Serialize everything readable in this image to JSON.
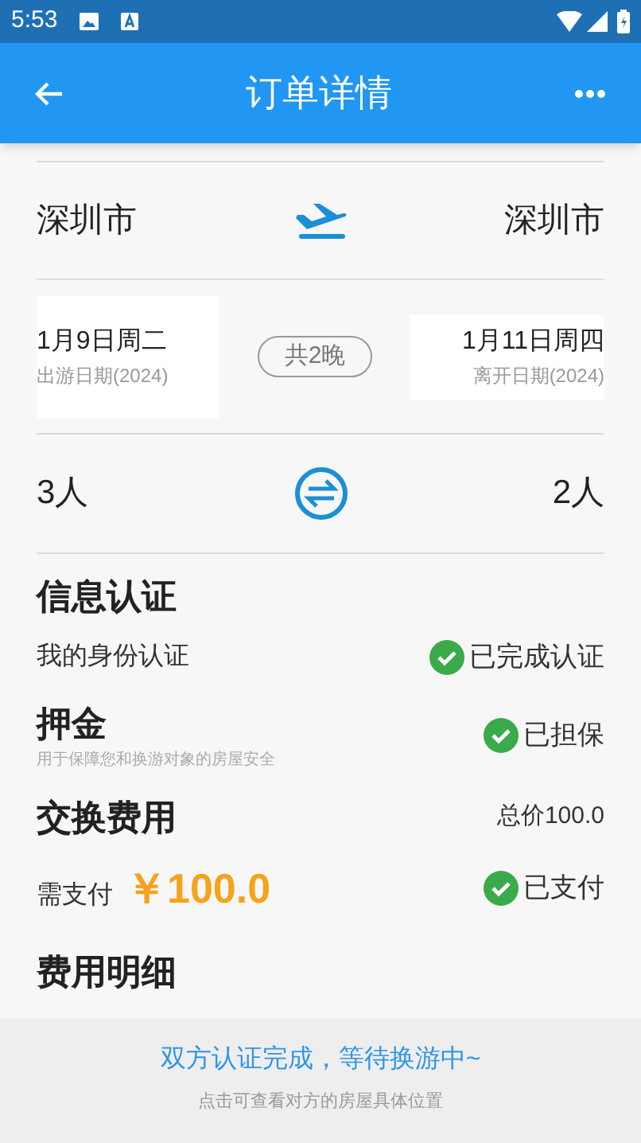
{
  "status_bar": {
    "time": "5:53"
  },
  "app_bar": {
    "title": "订单详情"
  },
  "route": {
    "from": "深圳市",
    "to": "深圳市"
  },
  "dates": {
    "start": {
      "date": "1月9日周二",
      "label": "出游日期(2024)"
    },
    "nights": "共2晚",
    "end": {
      "date": "1月11日周四",
      "label": "离开日期(2024)"
    }
  },
  "people": {
    "left": "3人",
    "right": "2人"
  },
  "verification": {
    "title": "信息认证",
    "label": "我的身份认证",
    "status": "已完成认证",
    "done": true
  },
  "deposit": {
    "title": "押金",
    "note": "用于保障您和换游对象的房屋安全",
    "status": "已担保",
    "done": true
  },
  "fee": {
    "title": "交换费用",
    "total": "总价100.0",
    "pay_label": "需支付",
    "amount": "￥100.0",
    "status": "已支付",
    "done": true
  },
  "details": {
    "title": "费用明细"
  },
  "footer": {
    "message": "双方认证完成，等待换游中~",
    "hint": "点击可查看对方的房屋具体位置"
  }
}
